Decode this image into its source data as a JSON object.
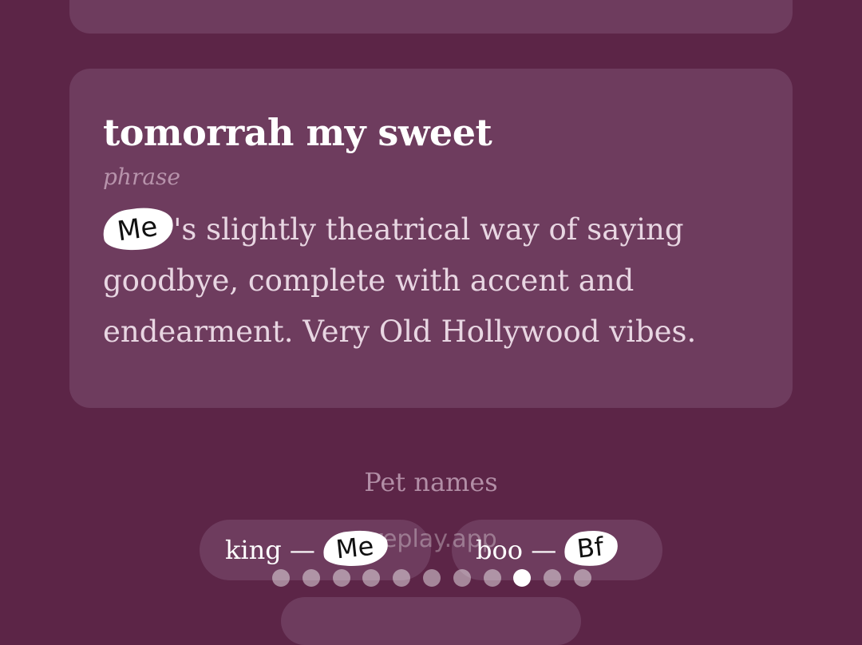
{
  "entry": {
    "term": "tomorrah my sweet",
    "part_of_speech": "phrase",
    "redaction_label": "Me",
    "definition_rest": "'s slightly theatrical way of saying goodbye, complete with accent and endearment. Very Old Hollywood vibes."
  },
  "pet_names": {
    "title": "Pet names",
    "chips": [
      {
        "name": "king",
        "separator": " — ",
        "owner": "Me"
      },
      {
        "name": "boo",
        "separator": " — ",
        "owner": "Bf"
      }
    ]
  },
  "watermark": "replay.app",
  "pagination": {
    "total": 11,
    "active_index": 8
  },
  "colors": {
    "background": "#5c2547",
    "card": "#6e3c5e",
    "active_dot": "#ffffff"
  }
}
